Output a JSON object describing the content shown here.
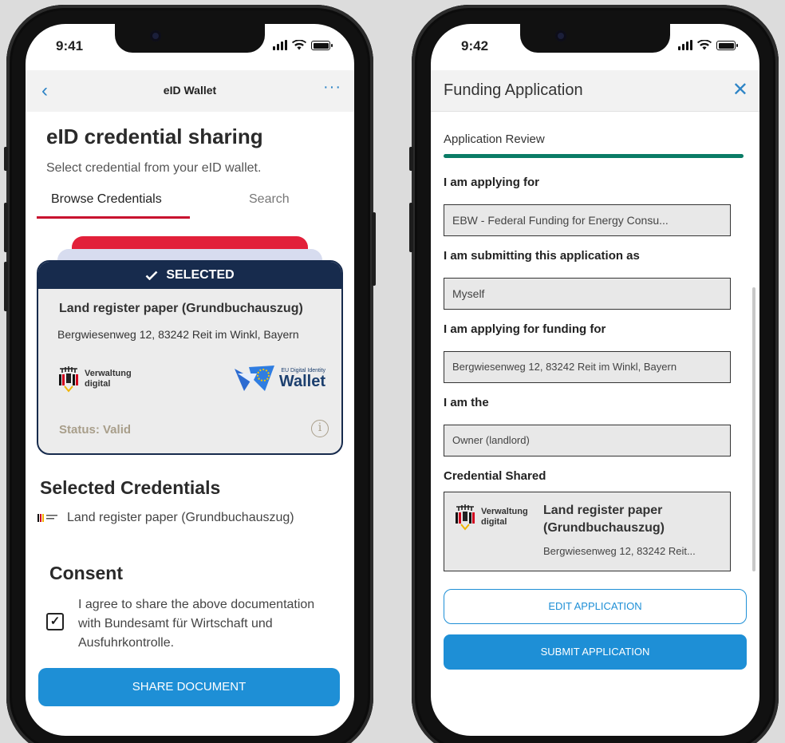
{
  "left_phone": {
    "status_time": "9:41",
    "nav": {
      "back_icon": "chevron-left-icon",
      "title": "eID Wallet",
      "more_icon": "ellipsis-icon"
    },
    "heading": "eID credential sharing",
    "subtitle": "Select credential from your eID wallet.",
    "tabs": [
      {
        "label": "Browse Credentials",
        "active": true
      },
      {
        "label": "Search",
        "active": false
      }
    ],
    "card": {
      "selected_label": "SELECTED",
      "title": "Land register paper (Grundbuchauszug)",
      "address": "Bergwiesenweg 12, 83242 Reit im Winkl, Bayern",
      "issuer_logo_text": [
        "Verwaltung",
        "digital"
      ],
      "wallet_logo_small": "EU Digital Identity",
      "wallet_logo_big": "Wallet",
      "status": "Status: Valid"
    },
    "selected_heading": "Selected Credentials",
    "selected_items": [
      {
        "label": "Land register paper (Grundbuchauszug)"
      }
    ],
    "consent_heading": "Consent",
    "consent_text": "I agree to share the above documentation with Bundesamt für Wirtschaft und Ausfuhrkontrolle.",
    "consent_checked": true,
    "share_button": "SHARE DOCUMENT",
    "colors": {
      "accent_blue": "#1e8fd6",
      "tab_red": "#c8102e",
      "card_navy": "#172b4d"
    }
  },
  "right_phone": {
    "status_time": "9:42",
    "nav": {
      "title": "Funding Application",
      "close_icon": "close-icon"
    },
    "step_label": "Application Review",
    "progress_fraction": 1.0,
    "questions": [
      {
        "label": "I am applying for",
        "value": "EBW - Federal Funding for Energy Consu..."
      },
      {
        "label": "I am submitting this application as",
        "value": "Myself"
      },
      {
        "label": "I am applying for funding for",
        "value": "Bergwiesenweg 12, 83242 Reit im Winkl, Bayern"
      },
      {
        "label": "I am the",
        "value": "Owner (landlord)"
      }
    ],
    "credential_heading": "Credential Shared",
    "credential": {
      "logo_text": [
        "Verwaltung",
        "digital"
      ],
      "title_line1": "Land register paper",
      "title_line2": "(Grundbuchauszug)",
      "address": "Bergwiesenweg 12, 83242 Reit..."
    },
    "edit_button": "EDIT APPLICATION",
    "submit_button": "SUBMIT APPLICATION",
    "colors": {
      "progress_green": "#0a7c66",
      "accent_blue": "#1e8fd6"
    }
  }
}
